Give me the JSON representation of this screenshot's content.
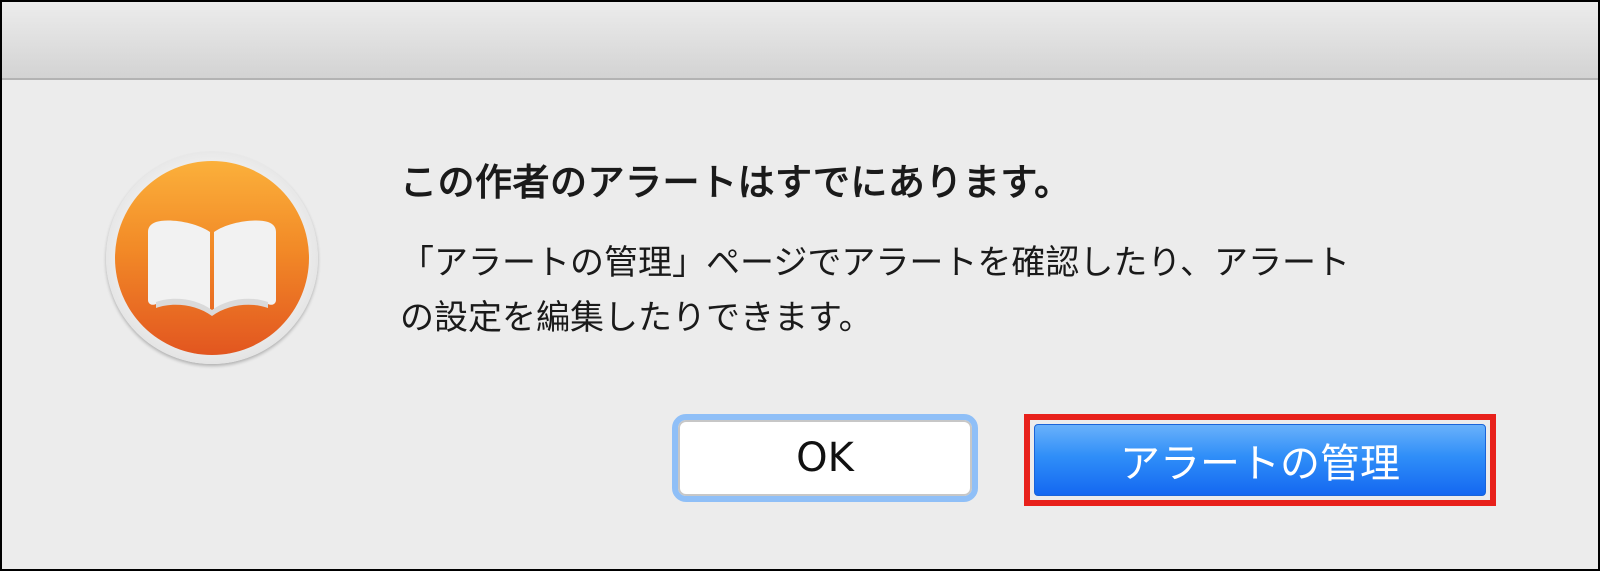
{
  "dialog": {
    "title": "この作者のアラートはすでにあります。",
    "message_lines": [
      "「アラートの管理」ページでアラートを確認したり、アラート",
      "の設定を編集したりできます。"
    ],
    "icon": "ibooks-app-icon",
    "buttons": {
      "ok_label": "OK",
      "manage_label": "アラートの管理"
    }
  },
  "colors": {
    "dialog_background": "#ececec",
    "default_button": "#2f8ef8",
    "highlight_box": "#e8211b",
    "icon_orange": "#f28a27"
  }
}
